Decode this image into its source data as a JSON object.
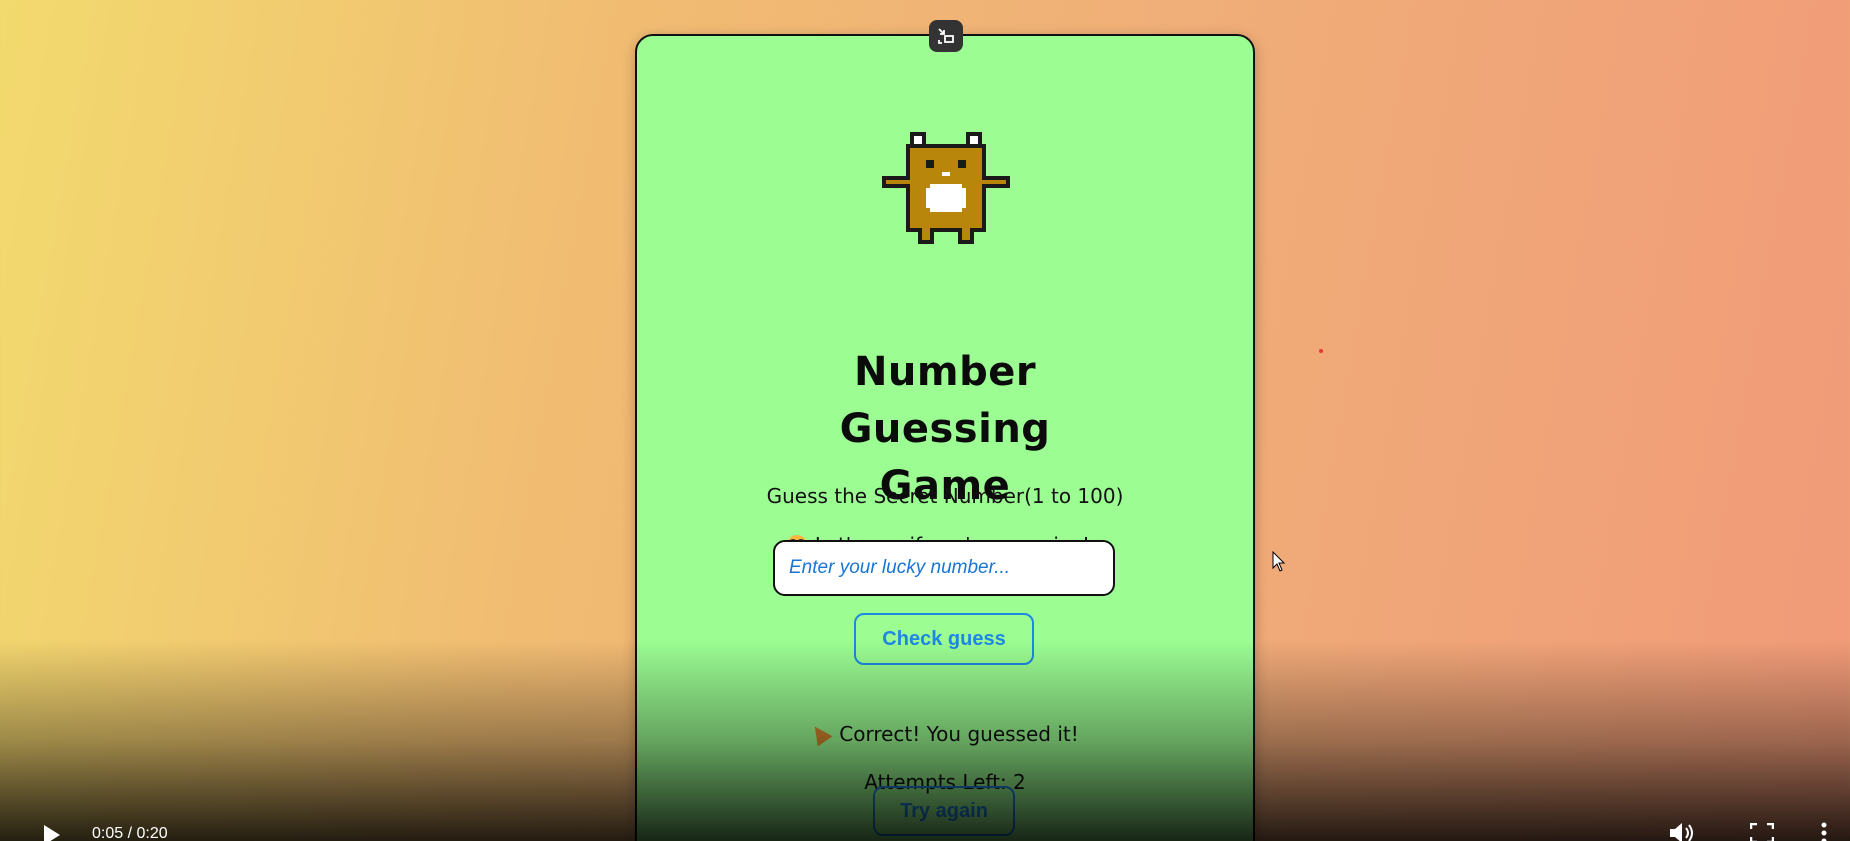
{
  "game": {
    "title": "Number Guessing Game",
    "subtitle": "Guess the Secret Number(1 to 100)",
    "prompt": "Let's see if you're a genius! :",
    "input_placeholder": "Enter your lucky number...",
    "check_label": "Check guess",
    "result_text": "Correct! You guessed it!",
    "attempts_text": "Attempts Left: 2",
    "try_again_label": "Try again"
  },
  "video_controls": {
    "time": "0:05 / 0:20"
  },
  "icons": {
    "exit_fullscreen": "exit-fullscreen-icon",
    "mascot": "pixel-bear-icon",
    "prompt_emoji": "face-emoji-icon",
    "result_emoji": "party-popper-icon",
    "play": "play-icon",
    "volume": "volume-icon",
    "fullscreen": "fullscreen-icon",
    "more": "more-options-icon"
  },
  "colors": {
    "card_background": "#9bfd92",
    "accent_blue": "#1e88e5",
    "mascot_brown": "#b8860b"
  }
}
